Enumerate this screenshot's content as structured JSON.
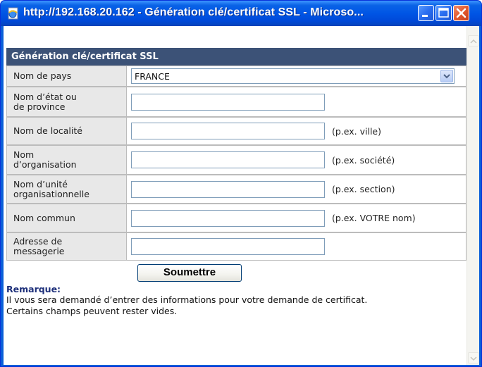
{
  "window": {
    "title": "http://192.168.20.162 - Génération clé/certificat SSL - Microso..."
  },
  "form": {
    "header": "Génération clé/certificat SSL",
    "country_label": "Nom de pays",
    "country_value": "FRANCE",
    "state_label_line1": "Nom d’état ou",
    "state_label_line2": "de province",
    "locality_label": "Nom de localité",
    "locality_hint": "(p.ex. ville)",
    "organization_label_line1": "Nom",
    "organization_label_line2": "d’organisation",
    "organization_hint": "(p.ex. société)",
    "unit_label_line1": "Nom d’unité",
    "unit_label_line2": "organisationnelle",
    "unit_hint": "(p.ex. section)",
    "common_name_label": "Nom commun",
    "common_name_hint": "(p.ex. VOTRE nom)",
    "email_label_line1": "Adresse de",
    "email_label_line2": "messagerie",
    "submit_label": "Soumettre"
  },
  "remark": {
    "title": "Remarque:",
    "line1": "Il vous sera demandé d’entrer des informations pour votre demande de certificat.",
    "line2": "Certains champs peuvent rester vides."
  },
  "colors": {
    "titlebar": "#0055e5",
    "section_header": "#3c5277",
    "label_bg": "#e8e8e8",
    "remark_title": "#1d2f7a"
  }
}
